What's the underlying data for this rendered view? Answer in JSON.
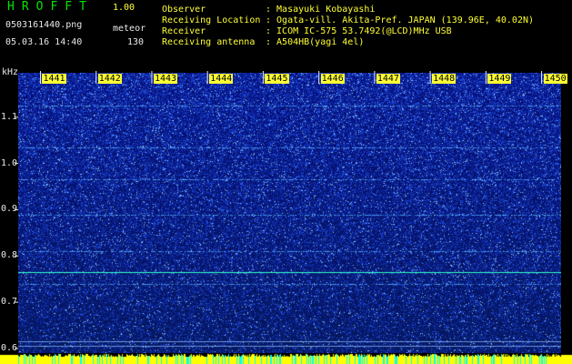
{
  "header": {
    "app_title": "HROFFT",
    "app_version": "1.00",
    "filename": "0503161440.png",
    "mode_label": "meteor",
    "timestamp": "05.03.16 14:40",
    "count_value": "130"
  },
  "info": {
    "observer_label": "Observer",
    "observer_value": ": Masayuki Kobayashi",
    "location_label": "Receiving Location",
    "location_value": ": Ogata-vill. Akita-Pref. JAPAN (139.96E, 40.02N)",
    "receiver_label": "Receiver",
    "receiver_value": ": ICOM IC-575 53.7492(@LCD)MHz USB",
    "antenna_label": "Receiving antenna",
    "antenna_value": ": A504HB(yagi 4el)"
  },
  "axes": {
    "y_unit": "kHz",
    "y_ticks": [
      "1.1",
      "1.0",
      "0.9",
      "0.8",
      "0.7",
      "0.6"
    ],
    "x_ticks": [
      "1441",
      "1442",
      "1443",
      "1444",
      "1445",
      "1446",
      "1447",
      "1448",
      "1449",
      "1450"
    ]
  },
  "spectrogram": {
    "x_min_minute": 1440.6,
    "x_max_minute": 1450.35,
    "y_min_khz": 0.59,
    "y_max_khz": 1.196,
    "background_color": "#0a1a7a",
    "noise_color": "#3a6aff",
    "line_color": "#33ffcc",
    "steady_lines_khz": [
      0.765,
      0.615,
      0.605
    ],
    "faint_lines_khz": [
      1.125,
      1.035,
      0.965,
      0.89,
      0.81,
      0.74
    ]
  },
  "colors": {
    "title": "#00e600",
    "info": "#ffff33",
    "label": "#e8e8e8",
    "tick_bg": "#ffff33",
    "strip_yellow": "#ffff00",
    "strip_cyan": "#00ffff"
  }
}
